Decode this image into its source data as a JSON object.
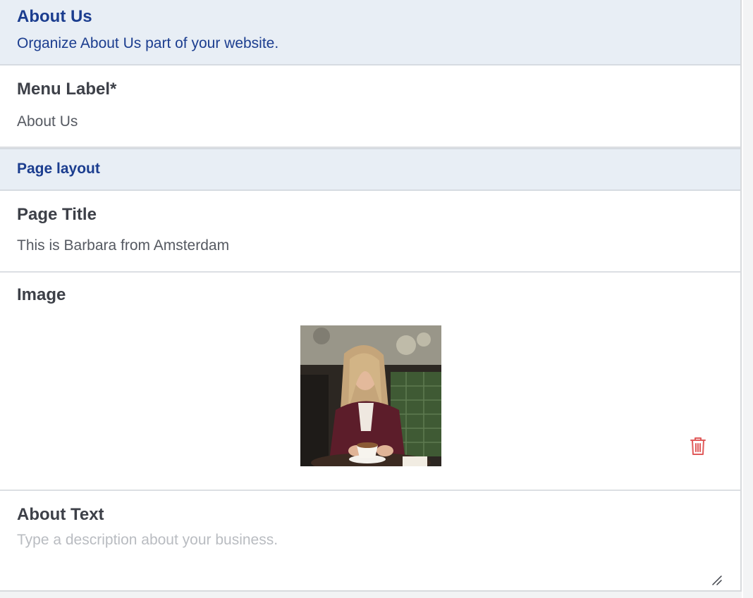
{
  "header": {
    "title": "About Us",
    "subtitle": "Organize About Us part of your website."
  },
  "menu_label": {
    "label": "Menu Label*",
    "value": "About Us"
  },
  "page_layout": {
    "title": "Page layout"
  },
  "page_title": {
    "label": "Page Title",
    "value": "This is Barbara from Amsterdam"
  },
  "image": {
    "label": "Image",
    "delete_icon": "trash-icon"
  },
  "about_text": {
    "label": "About Text",
    "value": "",
    "placeholder": "Type a description about your business."
  },
  "colors": {
    "header_bg": "#e8eef5",
    "header_text": "#1b3d8f",
    "label_text": "#3d4048",
    "value_text": "#555961",
    "placeholder_text": "#b9bcc1",
    "delete_red": "#e05a5a"
  }
}
